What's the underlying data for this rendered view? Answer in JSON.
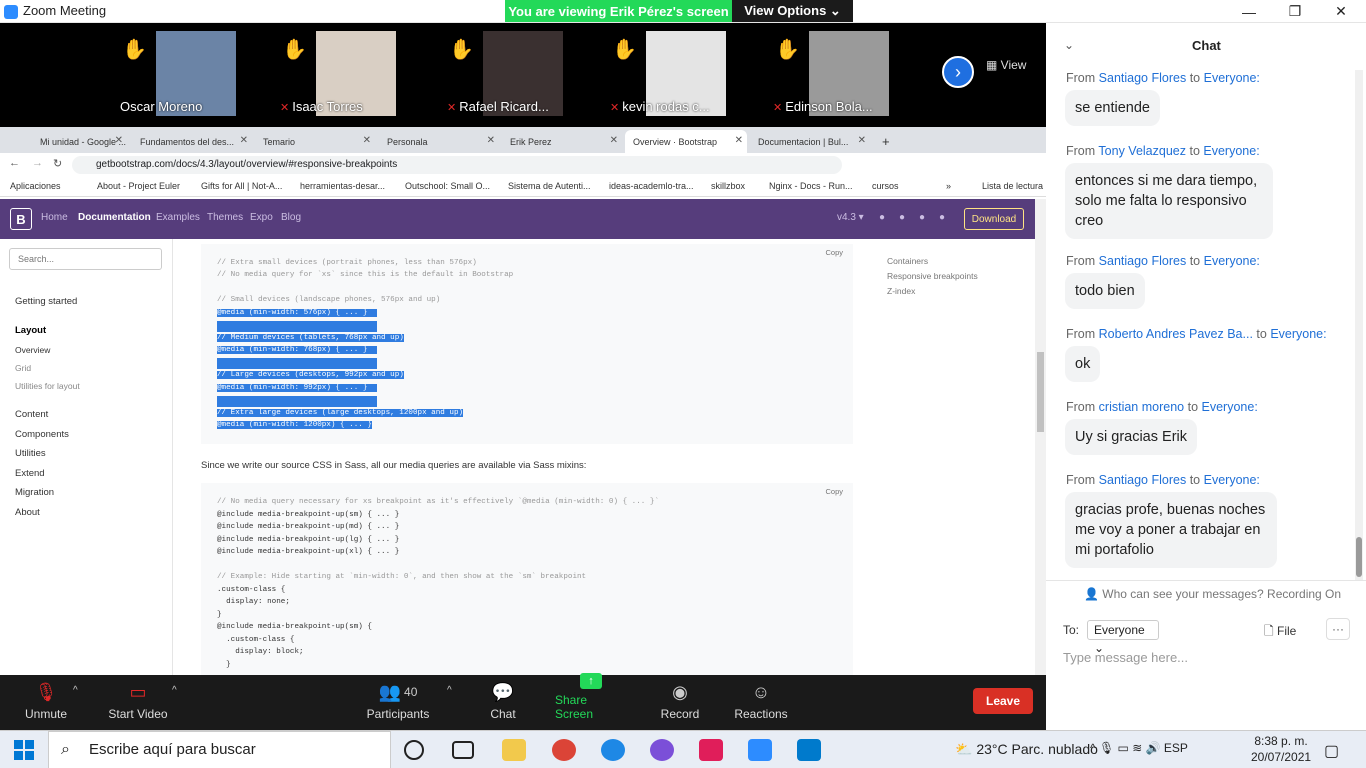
{
  "window": {
    "title": "Zoom Meeting",
    "minimize": "—",
    "restore": "❐",
    "close": "✕"
  },
  "banner": {
    "viewing": "You are viewing Erik Pérez's screen",
    "view_options": "View Options ⌄"
  },
  "gallery": {
    "view_label": "View",
    "participants": [
      {
        "name": "Oscar Moreno",
        "muted": false,
        "photo_color": "#6b84a6"
      },
      {
        "name": "Isaac Torres",
        "muted": true,
        "photo_color": "#d9cfc4"
      },
      {
        "name": "Rafael Ricard...",
        "muted": true,
        "photo_color": "#3a3030"
      },
      {
        "name": "kevin rodas c...",
        "muted": true,
        "photo_color": "#e4e4e4"
      },
      {
        "name": "Edinson Bola...",
        "muted": true,
        "photo_color": "#9a9a9a"
      }
    ]
  },
  "browser": {
    "tabs": [
      {
        "label": "Mi unidad - Google ..."
      },
      {
        "label": "Fundamentos del des..."
      },
      {
        "label": "Temario"
      },
      {
        "label": "Personala"
      },
      {
        "label": "Erik Perez"
      },
      {
        "label": "Overview · Bootstrap"
      },
      {
        "label": "Documentacion | Bul..."
      }
    ],
    "new_tab": "+",
    "url": "getbootstrap.com/docs/4.3/layout/overview/#responsive-breakpoints",
    "bookmarks": [
      "Aplicaciones",
      "About - Project Euler",
      "Gifts for All | Not-A...",
      "herramientas-desar...",
      "Outschool: Small O...",
      "Sistema de Autenti...",
      "ideas-academlo-tra...",
      "skillzbox",
      "Nginx - Docs - Run...",
      "cursos",
      "»",
      "Lista de lectura"
    ]
  },
  "bootstrap": {
    "logo": "B",
    "nav": [
      "Home",
      "Documentation",
      "Examples",
      "Themes",
      "Expo",
      "Blog"
    ],
    "version": "v4.3 ▾",
    "download": "Download",
    "search_placeholder": "Search...",
    "sidebar": [
      "Getting started",
      "Layout",
      "Overview",
      "Grid",
      "Utilities for layout",
      "Content",
      "Components",
      "Utilities",
      "Extend",
      "Migration",
      "About"
    ],
    "toc": [
      "Containers",
      "Responsive breakpoints",
      "Z-index"
    ],
    "copy": "Copy",
    "code1": [
      "// Extra small devices (portrait phones, less than 576px)",
      "// No media query for `xs` since this is the default in Bootstrap",
      "",
      "// Small devices (landscape phones, 576px and up)",
      "@media (min-width: 576px) { ... }",
      "",
      "// Medium devices (tablets, 768px and up)",
      "@media (min-width: 768px) { ... }",
      "",
      "// Large devices (desktops, 992px and up)",
      "@media (min-width: 992px) { ... }",
      "",
      "// Extra large devices (large desktops, 1200px and up)",
      "@media (min-width: 1200px) { ... }"
    ],
    "paragraph": "Since we write our source CSS in Sass, all our media queries are available via Sass mixins:",
    "code2": [
      "// No media query necessary for xs breakpoint as it's effectively `@media (min-width: 0) { ... }`",
      "@include media-breakpoint-up(sm) { ... }",
      "@include media-breakpoint-up(md) { ... }",
      "@include media-breakpoint-up(lg) { ... }",
      "@include media-breakpoint-up(xl) { ... }",
      "",
      "// Example: Hide starting at `min-width: 0`, and then show at the `sm` breakpoint",
      ".custom-class {",
      "  display: none;",
      "}",
      "@include media-breakpoint-up(sm) {",
      "  .custom-class {",
      "    display: block;",
      "  }"
    ]
  },
  "toolbar": {
    "unmute": "Unmute",
    "start_video": "Start Video",
    "participants": "Participants",
    "participants_count": "40",
    "chat": "Chat",
    "share_screen": "Share Screen",
    "record": "Record",
    "reactions": "Reactions",
    "leave": "Leave"
  },
  "chat": {
    "title": "Chat",
    "messages": [
      {
        "from": "Santiago Flores",
        "to": "Everyone:",
        "text": "se entiende"
      },
      {
        "from": "Tony Velazquez",
        "to": "Everyone:",
        "text": "entonces si me dara tiempo, solo me falta lo responsivo creo"
      },
      {
        "from": "Santiago Flores",
        "to": "Everyone:",
        "text": "todo bien"
      },
      {
        "from": "Roberto Andres Pavez Ba...",
        "to": "Everyone:",
        "text": "ok"
      },
      {
        "from": "cristian moreno",
        "to": "Everyone:",
        "text": "Uy si gracias Erik"
      },
      {
        "from": "Santiago Flores",
        "to": "Everyone:",
        "text": "gracias profe, buenas noches me voy a poner a trabajar en mi portafolio"
      }
    ],
    "from_word": "From",
    "to_word": "to",
    "who_can_see": "Who can see your messages? Recording On",
    "to_label": "To:",
    "to_value": "Everyone",
    "file": "File",
    "more": "···",
    "input_placeholder": "Type message here..."
  },
  "taskbar": {
    "search": "Escribe aquí para buscar",
    "weather": "23°C  Parc. nublado",
    "lang": "ESP",
    "time": "8:38 p. m.",
    "date": "20/07/2021"
  }
}
